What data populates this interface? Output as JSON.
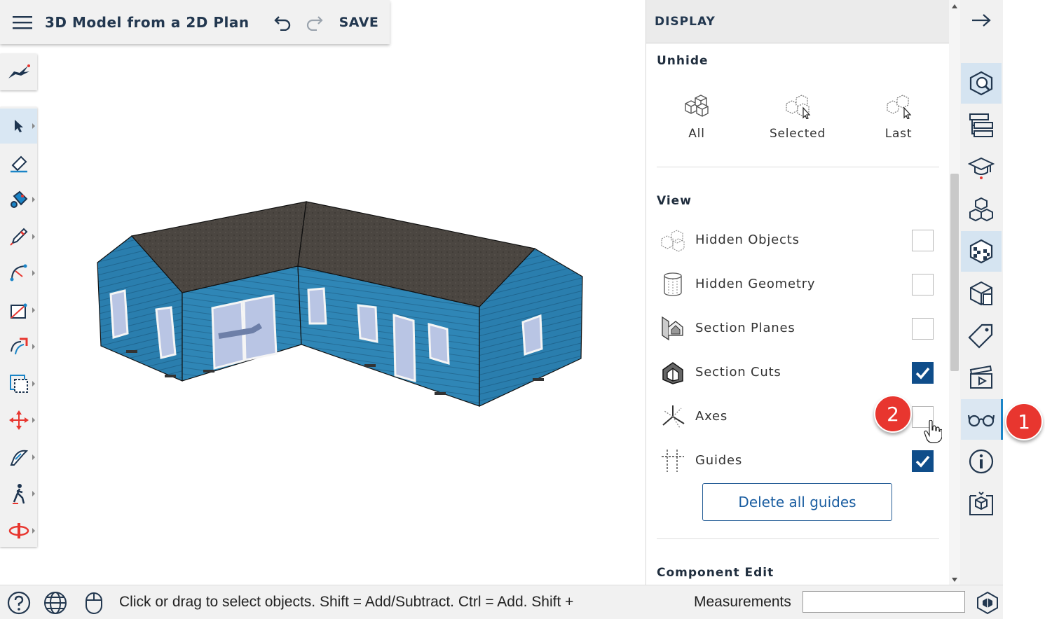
{
  "header": {
    "menu_icon": "hamburger-menu-icon",
    "title": "3D Model from a 2D Plan",
    "undo_icon": "undo-icon",
    "redo_icon": "redo-icon",
    "save_label": "SAVE"
  },
  "left_toolbar": {
    "logo_icon": "sketchup-logo-icon",
    "tools": [
      "select-tool-icon",
      "eraser-tool-icon",
      "paint-bucket-icon",
      "pencil-line-icon",
      "arc-tool-icon",
      "rectangle-tool-icon",
      "push-pull-icon",
      "offset-tool-icon",
      "move-tool-icon",
      "tape-measure-icon",
      "walk-tool-icon",
      "orbit-tool-icon"
    ]
  },
  "display_panel": {
    "title": "DISPLAY",
    "unhide": {
      "title": "Unhide",
      "buttons": [
        {
          "label": "All",
          "icon": "unhide-all-icon"
        },
        {
          "label": "Selected",
          "icon": "unhide-selected-icon"
        },
        {
          "label": "Last",
          "icon": "unhide-last-icon"
        }
      ]
    },
    "view": {
      "title": "View",
      "rows": [
        {
          "label": "Hidden Objects",
          "icon": "hidden-objects-icon",
          "checked": false
        },
        {
          "label": "Hidden Geometry",
          "icon": "hidden-geometry-icon",
          "checked": false
        },
        {
          "label": "Section Planes",
          "icon": "section-planes-icon",
          "checked": false
        },
        {
          "label": "Section Cuts",
          "icon": "section-cuts-icon",
          "checked": true
        },
        {
          "label": "Axes",
          "icon": "axes-icon",
          "checked": false
        },
        {
          "label": "Guides",
          "icon": "guides-icon",
          "checked": true
        }
      ],
      "delete_guides_label": "Delete all guides"
    },
    "component_edit_title": "Component Edit"
  },
  "right_tray": {
    "collapse_icon": "arrow-right-icon",
    "items": [
      "entity-info-icon",
      "outliner-icon",
      "instructor-icon",
      "components-icon",
      "materials-icon",
      "styles-icon",
      "tags-icon",
      "scenes-icon",
      "display-glasses-icon",
      "model-info-icon",
      "3d-warehouse-icon"
    ]
  },
  "markers": {
    "first": "1",
    "second": "2"
  },
  "status_bar": {
    "help_icon": "help-icon",
    "globe_icon": "globe-icon",
    "mouse_icon": "mouse-icon",
    "hint": "Click or drag to select objects. Shift = Add/Subtract. Ctrl = Add. Shift +",
    "measurements_label": "Measurements",
    "measurements_value": ""
  },
  "colors": {
    "accent": "#0f4d8a",
    "siding": "#2f86b6",
    "roof": "#4a4540",
    "marker": "#e8362f"
  }
}
